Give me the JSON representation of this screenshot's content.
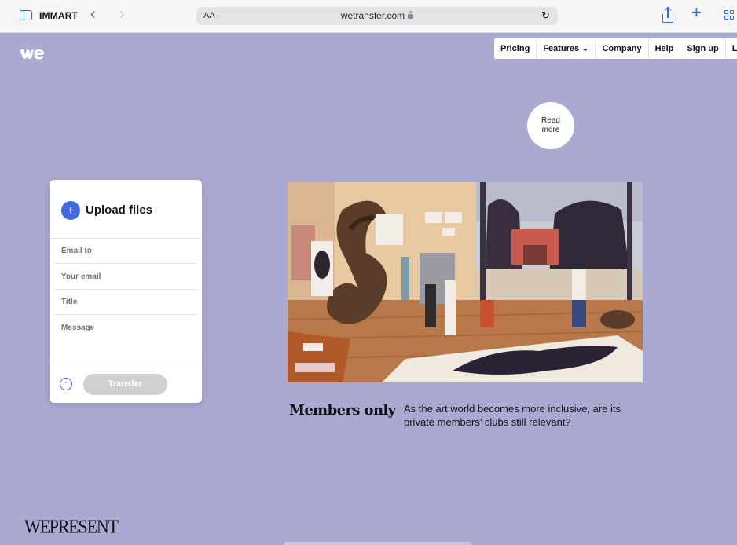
{
  "browser": {
    "tab_group_label": "IMMART",
    "url_display": "wetransfer.com",
    "text_size_label": "AA",
    "back_glyph": "‹",
    "forward_glyph": "›",
    "reload_glyph": "↻",
    "new_tab_glyph": "+"
  },
  "site": {
    "brand_color": "#a9a9d2",
    "accent_color": "#4169e1"
  },
  "nav": {
    "items": [
      {
        "label": "Pricing"
      },
      {
        "label": "Features ⌄"
      },
      {
        "label": "Company"
      },
      {
        "label": "Help"
      },
      {
        "label": "Sign up"
      },
      {
        "label": "Log in"
      }
    ]
  },
  "read_more": {
    "label": "Read\nmore"
  },
  "upload_card": {
    "add_glyph": "+",
    "title": "Upload files",
    "fields": {
      "email_to": "Email to",
      "your_email": "Your email",
      "title": "Title",
      "message": "Message"
    },
    "more_glyph": "···",
    "transfer_label": "Transfer"
  },
  "feature": {
    "title": "Members only",
    "description": "As the art world becomes more inclusive, are its private members’ clubs still relevant?"
  },
  "footer": {
    "wordmark": "WEPRESENT"
  }
}
